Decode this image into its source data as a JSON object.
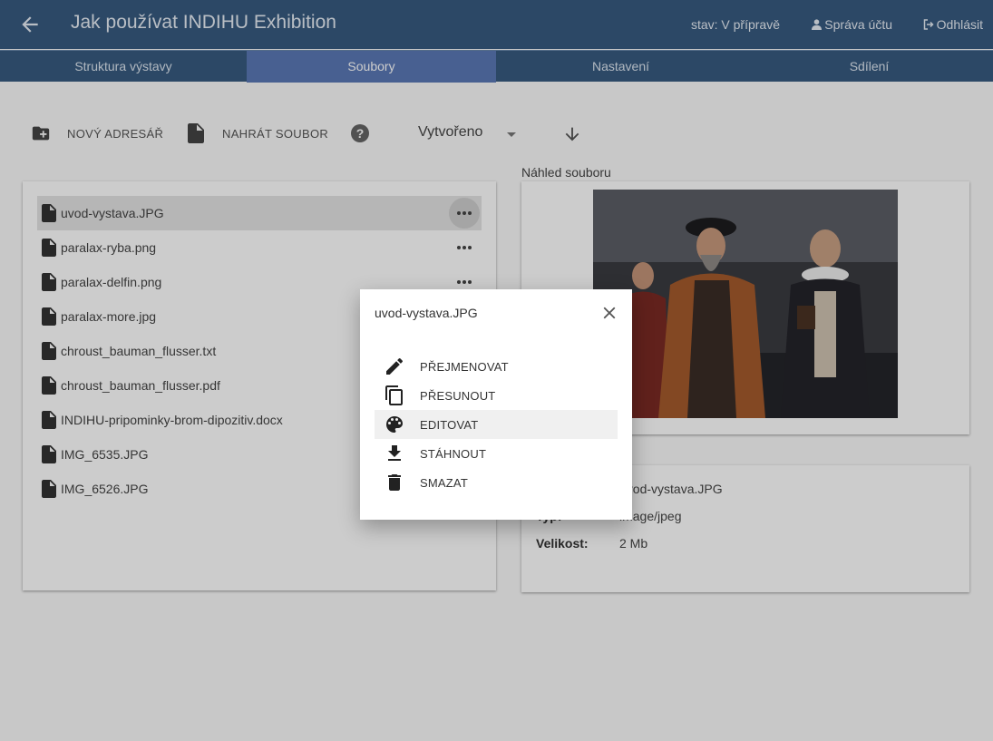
{
  "header": {
    "title": "Jak používat INDIHU Exhibition",
    "status": "stav: V přípravě",
    "account_label": "Správa účtu",
    "logout_label": "Odhlásit"
  },
  "tabs": [
    {
      "label": "Struktura výstavy",
      "active": false
    },
    {
      "label": "Soubory",
      "active": true
    },
    {
      "label": "Nastavení",
      "active": false
    },
    {
      "label": "Sdílení",
      "active": false
    }
  ],
  "toolbar": {
    "new_folder_label": "NOVÝ ADRESÁŘ",
    "upload_label": "NAHRÁT SOUBOR",
    "sort_value": "Vytvořeno"
  },
  "files": [
    {
      "name": "uvod-vystava.JPG"
    },
    {
      "name": "paralax-ryba.png"
    },
    {
      "name": "paralax-delfin.png"
    },
    {
      "name": "paralax-more.jpg"
    },
    {
      "name": "chroust_bauman_flusser.txt"
    },
    {
      "name": "chroust_bauman_flusser.pdf"
    },
    {
      "name": "INDIHU-pripominky-brom-dipozitiv.docx"
    },
    {
      "name": "IMG_6535.JPG"
    },
    {
      "name": "IMG_6526.JPG"
    }
  ],
  "preview": {
    "label": "Náhled souboru"
  },
  "info": {
    "name_value": "uvod-vystava.JPG",
    "type_label": "Typ:",
    "type_value": "image/jpeg",
    "size_label": "Velikost:",
    "size_value": "2 Mb"
  },
  "dialog": {
    "title": "uvod-vystava.JPG",
    "items": [
      {
        "label": "PŘEJMENOVAT",
        "icon": "pencil-icon"
      },
      {
        "label": "PŘESUNOUT",
        "icon": "copy-icon"
      },
      {
        "label": "EDITOVAT",
        "icon": "palette-icon"
      },
      {
        "label": "STÁHNOUT",
        "icon": "download-icon"
      },
      {
        "label": "SMAZAT",
        "icon": "trash-icon"
      }
    ]
  },
  "colors": {
    "appbar": "#375a80",
    "active_tab": "#5b79b6"
  }
}
